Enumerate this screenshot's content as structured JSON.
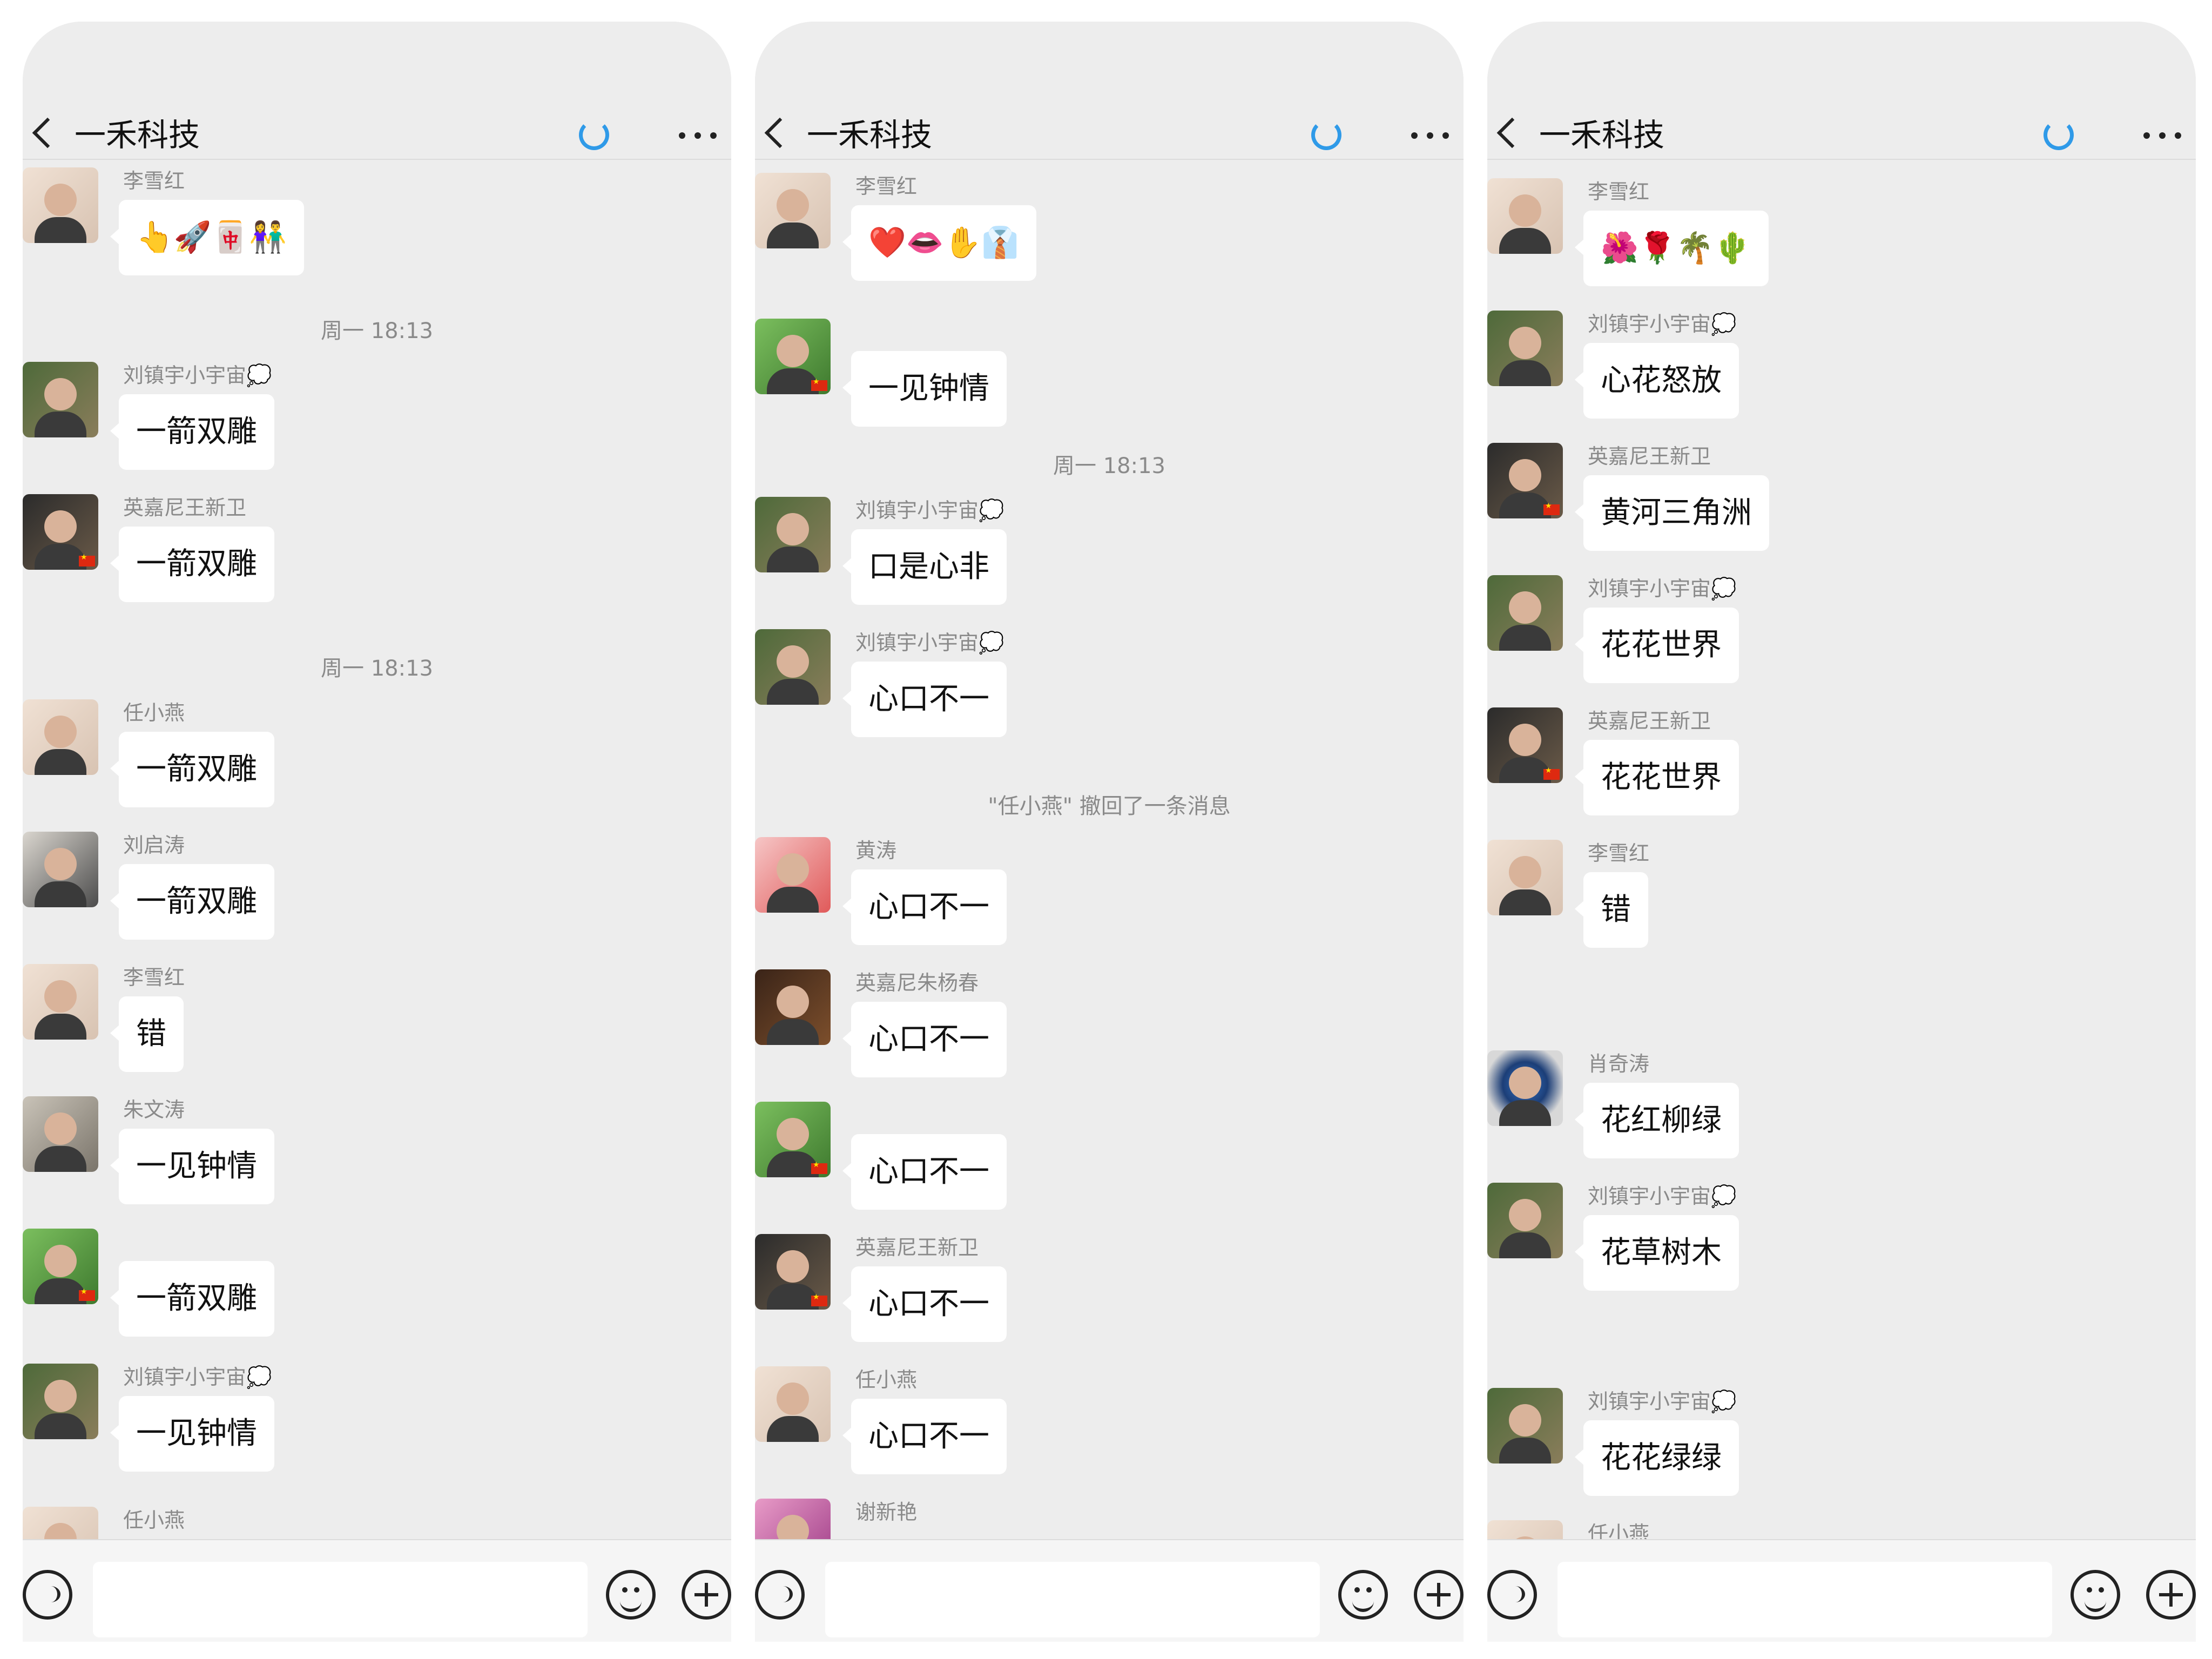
{
  "chat_title": "一禾科技",
  "screens": [
    {
      "items": [
        {
          "type": "msg",
          "sender": "李雪红",
          "text": "👆🚀🀄👫",
          "avatar": "photo",
          "flag": false
        },
        {
          "type": "time",
          "text": "周一 18:13"
        },
        {
          "type": "msg",
          "sender": "刘镇宇小宇宙💭",
          "text": "一箭双雕",
          "avatar": "green",
          "flag": false
        },
        {
          "type": "msg",
          "sender": "英嘉尼王新卫",
          "text": "一箭双雕",
          "avatar": "dark",
          "flag": true
        },
        {
          "type": "time",
          "text": "周一 18:13"
        },
        {
          "type": "msg",
          "sender": "任小燕",
          "text": "一箭双雕",
          "avatar": "photo",
          "flag": false
        },
        {
          "type": "msg",
          "sender": "刘启涛",
          "text": "一箭双雕",
          "avatar": "desk",
          "flag": false
        },
        {
          "type": "msg",
          "sender": "李雪红",
          "text": "错",
          "avatar": "photo",
          "flag": false
        },
        {
          "type": "msg",
          "sender": "朱文涛",
          "text": "一见钟情",
          "avatar": "suit",
          "flag": false
        },
        {
          "type": "msg",
          "sender": "",
          "text": "一箭双雕",
          "avatar": "plant",
          "flag": true
        },
        {
          "type": "msg",
          "sender": "刘镇宇小宇宙💭",
          "text": "一见钟情",
          "avatar": "green",
          "flag": false
        },
        {
          "type": "msg",
          "sender": "任小燕",
          "text": "",
          "avatar": "photo",
          "flag": false
        }
      ]
    },
    {
      "items": [
        {
          "type": "msg",
          "sender": "李雪红",
          "text": "❤️👄✋👔",
          "avatar": "photo",
          "flag": false
        },
        {
          "type": "msg",
          "sender": "",
          "text": "一见钟情",
          "avatar": "plant",
          "flag": true
        },
        {
          "type": "time",
          "text": "周一 18:13"
        },
        {
          "type": "msg",
          "sender": "刘镇宇小宇宙💭",
          "text": "口是心非",
          "avatar": "green",
          "flag": false
        },
        {
          "type": "msg",
          "sender": "刘镇宇小宇宙💭",
          "text": "心口不一",
          "avatar": "green",
          "flag": false
        },
        {
          "type": "notice",
          "text": "\"任小燕\" 撤回了一条消息"
        },
        {
          "type": "msg",
          "sender": "黄涛",
          "text": "心口不一",
          "avatar": "pink",
          "flag": false
        },
        {
          "type": "msg",
          "sender": "英嘉尼朱杨春",
          "text": "心口不一",
          "avatar": "room",
          "flag": false
        },
        {
          "type": "msg",
          "sender": "",
          "text": "心口不一",
          "avatar": "plant",
          "flag": true
        },
        {
          "type": "msg",
          "sender": "英嘉尼王新卫",
          "text": "心口不一",
          "avatar": "dark",
          "flag": true
        },
        {
          "type": "msg",
          "sender": "任小燕",
          "text": "心口不一",
          "avatar": "photo",
          "flag": false
        },
        {
          "type": "msg",
          "sender": "谢新艳",
          "text": "",
          "avatar": "flower",
          "flag": false
        }
      ]
    },
    {
      "items": [
        {
          "type": "msg",
          "sender": "李雪红",
          "text": "🌺🌹🌴🌵",
          "avatar": "photo",
          "flag": false
        },
        {
          "type": "msg",
          "sender": "刘镇宇小宇宙💭",
          "text": "心花怒放",
          "avatar": "green",
          "flag": false
        },
        {
          "type": "msg",
          "sender": "英嘉尼王新卫",
          "text": "黄河三角洲",
          "avatar": "dark",
          "flag": true
        },
        {
          "type": "msg",
          "sender": "刘镇宇小宇宙💭",
          "text": "花花世界",
          "avatar": "green",
          "flag": false
        },
        {
          "type": "msg",
          "sender": "英嘉尼王新卫",
          "text": "花花世界",
          "avatar": "dark",
          "flag": true
        },
        {
          "type": "msg",
          "sender": "李雪红",
          "text": "错",
          "avatar": "photo",
          "flag": false
        },
        {
          "type": "msg",
          "sender": "肖奇涛",
          "text": "花红柳绿",
          "avatar": "globe",
          "flag": false
        },
        {
          "type": "msg",
          "sender": "刘镇宇小宇宙💭",
          "text": "花草树木",
          "avatar": "green",
          "flag": false
        },
        {
          "type": "msg",
          "sender": "刘镇宇小宇宙💭",
          "text": "花花绿绿",
          "avatar": "green",
          "flag": false
        },
        {
          "type": "msg",
          "sender": "任小燕",
          "text": "",
          "avatar": "photo",
          "flag": false
        }
      ]
    }
  ]
}
